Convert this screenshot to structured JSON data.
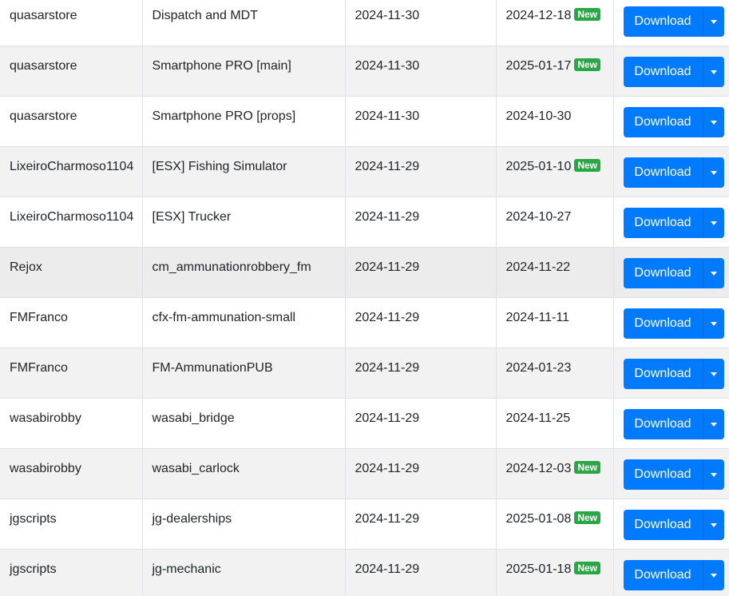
{
  "badge_label": "New",
  "download_label": "Download",
  "dropdown_icon": "caret-down-icon",
  "colors": {
    "primary": "#007bff",
    "badge": "#28a745",
    "stripe": "#f2f2f2",
    "hover": "#ececec",
    "border": "#dee2e6"
  },
  "rows": [
    {
      "author": "quasarstore",
      "resource": "Dispatch and MDT",
      "created": "2024-11-30",
      "updated": "2024-12-18",
      "is_new": true
    },
    {
      "author": "quasarstore",
      "resource": "Smartphone PRO [main]",
      "created": "2024-11-30",
      "updated": "2025-01-17",
      "is_new": true
    },
    {
      "author": "quasarstore",
      "resource": "Smartphone PRO [props]",
      "created": "2024-11-30",
      "updated": "2024-10-30",
      "is_new": false
    },
    {
      "author": "LixeiroCharmoso1104",
      "resource": "[ESX] Fishing Simulator",
      "created": "2024-11-29",
      "updated": "2025-01-10",
      "is_new": true
    },
    {
      "author": "LixeiroCharmoso1104",
      "resource": "[ESX] Trucker",
      "created": "2024-11-29",
      "updated": "2024-10-27",
      "is_new": false
    },
    {
      "author": "Rejox",
      "resource": "cm_ammunationrobbery_fm",
      "created": "2024-11-29",
      "updated": "2024-11-22",
      "is_new": false
    },
    {
      "author": "FMFranco",
      "resource": "cfx-fm-ammunation-small",
      "created": "2024-11-29",
      "updated": "2024-11-11",
      "is_new": false
    },
    {
      "author": "FMFranco",
      "resource": "FM-AmmunationPUB",
      "created": "2024-11-29",
      "updated": "2024-01-23",
      "is_new": false
    },
    {
      "author": "wasabirobby",
      "resource": "wasabi_bridge",
      "created": "2024-11-29",
      "updated": "2024-11-25",
      "is_new": false
    },
    {
      "author": "wasabirobby",
      "resource": "wasabi_carlock",
      "created": "2024-11-29",
      "updated": "2024-12-03",
      "is_new": true
    },
    {
      "author": "jgscripts",
      "resource": "jg-dealerships",
      "created": "2024-11-29",
      "updated": "2025-01-08",
      "is_new": true
    },
    {
      "author": "jgscripts",
      "resource": "jg-mechanic",
      "created": "2024-11-29",
      "updated": "2025-01-18",
      "is_new": true
    }
  ]
}
